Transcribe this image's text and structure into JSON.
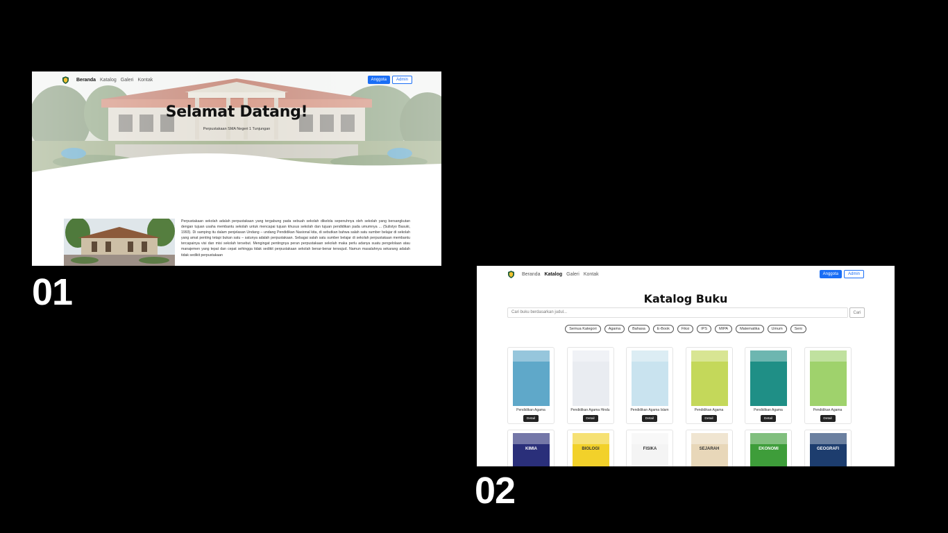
{
  "screens": {
    "first": {
      "label": "01",
      "nav": {
        "items": [
          "Beranda",
          "Katalog",
          "Galeri",
          "Kontak"
        ],
        "active_index": 0,
        "member_button": "Anggota",
        "admin_button": "Admin"
      },
      "hero": {
        "title": "Selamat Datang!",
        "subtitle": "Perpustakaan SMA Negeri 1 Tunjungan"
      },
      "about": {
        "text": "Perpustakaan sekolah adalah perpustakaan yang tergabung pada sebuah sekolah dikelola sepenuhnya oleh sekolah yang bersangkutan dengan tujuan usaha membantu sekolah untuk mencapai tujuan khusus sekolah dan tujuan pendidikan pada umumnya ... (Sulistyo Basuki, 1993). Di samping itu dalam penjelasan Undang – undang Pendidikan Nasional kita, di sebutkan bahwa salah satu sumber belajar di sekolah yang amat penting tetapi bukan satu – satunya adalah perpustakaan. Sebagai salah satu sumber belajar di sekolah perpustakaan membantu tercapainya visi dan misi sekolah tersebut. Mengingat pentingnya peran perpustakaan sekolah maka perlu adanya suatu pengelolaan atau manajemen yang tepat dan cepat sehingga tidak sedikit perpustakaan sekolah benar-benar terwujud. Namun masalahnya sekarang adalah tidak sedikit perpustakaan"
      }
    },
    "second": {
      "label": "02",
      "nav": {
        "items": [
          "Beranda",
          "Katalog",
          "Galeri",
          "Kontak"
        ],
        "active_index": 1,
        "member_button": "Anggota",
        "admin_button": "Admin"
      },
      "catalog_title": "Katalog Buku",
      "search": {
        "placeholder": "Cari buku berdasarkan judul...",
        "button": "Cari"
      },
      "categories": [
        "Semua Kategori",
        "Agama",
        "Bahasa",
        "E-Book",
        "Fiksi",
        "IPS",
        "MIPA",
        "Matematika",
        "Umum",
        "Seni"
      ],
      "books": [
        {
          "title": "Pendidikan Agama",
          "detail": "Detail",
          "cover_color": "#5fa8c9",
          "cover_word": ""
        },
        {
          "title": "Pendidikan Agama Hindu",
          "detail": "Detail",
          "cover_color": "#e9ecf1",
          "cover_word": ""
        },
        {
          "title": "Pendidikan Agama Islam",
          "detail": "Detail",
          "cover_color": "#c9e3ef",
          "cover_word": ""
        },
        {
          "title": "Pendidikan Agama",
          "detail": "Detail",
          "cover_color": "#c4d85a",
          "cover_word": ""
        },
        {
          "title": "Pendidikan Agama",
          "detail": "Detail",
          "cover_color": "#1f8f86",
          "cover_word": ""
        },
        {
          "title": "Pendidikan Agama",
          "detail": "Detail",
          "cover_color": "#9fd26c",
          "cover_word": ""
        },
        {
          "title": "",
          "detail": "",
          "cover_color": "#2a2f7a",
          "cover_word": "KIMIA"
        },
        {
          "title": "",
          "detail": "",
          "cover_color": "#f2d12a",
          "cover_word": "BIOLOGI"
        },
        {
          "title": "",
          "detail": "",
          "cover_color": "#f4f4f4",
          "cover_word": "FISIKA"
        },
        {
          "title": "",
          "detail": "",
          "cover_color": "#e8d7b9",
          "cover_word": "SEJARAH"
        },
        {
          "title": "",
          "detail": "",
          "cover_color": "#3e9d3a",
          "cover_word": "EKONOMI"
        },
        {
          "title": "",
          "detail": "",
          "cover_color": "#1d3d6e",
          "cover_word": "GEOGRAFI"
        }
      ]
    }
  },
  "colors": {
    "background": "#000000",
    "primary": "#1a6ef5",
    "dark_button": "#222222"
  },
  "icons": [
    "school-shield-logo"
  ]
}
